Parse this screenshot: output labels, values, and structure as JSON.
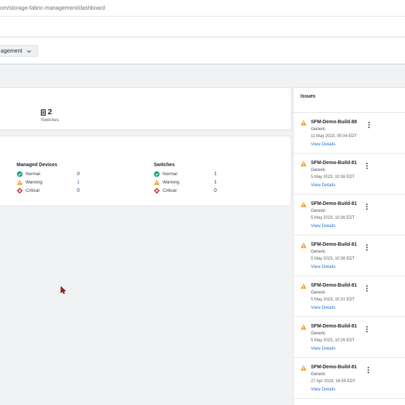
{
  "browser": {
    "url": "om/storage-fabric-management/dashboard"
  },
  "nav": {
    "dropdown_label": "agement"
  },
  "summary": {
    "switch_count": "2",
    "switch_label": "Switches"
  },
  "status": {
    "devices": {
      "title": "Managed Devices",
      "rows": [
        {
          "label": "Normal",
          "value": "0"
        },
        {
          "label": "Warning",
          "value": "1"
        },
        {
          "label": "Critical",
          "value": "0"
        }
      ]
    },
    "switches": {
      "title": "Switches",
      "rows": [
        {
          "label": "Normal",
          "value": "1"
        },
        {
          "label": "Warning",
          "value": "1"
        },
        {
          "label": "Critical",
          "value": "0"
        }
      ]
    }
  },
  "issues": {
    "title": "Issues",
    "items": [
      {
        "title": "SFM-Demo-Build-88",
        "type": "Generic",
        "time": "11 May 2023, 05:04 EDT",
        "link": "View Details"
      },
      {
        "title": "SFM-Demo-Build-81",
        "type": "Generic",
        "time": "5 May 2023, 10:36 EDT",
        "link": "View Details"
      },
      {
        "title": "SFM-Demo-Build-81",
        "type": "Generic",
        "time": "5 May 2023, 10:36 EDT",
        "link": "View Details"
      },
      {
        "title": "SFM-Demo-Build-81",
        "type": "Generic",
        "time": "5 May 2023, 10:36 EDT",
        "link": "View Details"
      },
      {
        "title": "SFM-Demo-Build-81",
        "type": "Generic",
        "time": "5 May 2023, 10:31 EDT",
        "link": "View Details"
      },
      {
        "title": "SFM-Demo-Build-81",
        "type": "Generic",
        "time": "5 May 2023, 10:26 EDT",
        "link": "View Details"
      },
      {
        "title": "SFM-Demo-Build-81",
        "type": "Generic",
        "time": "27 Apr 2023, 16:59 EDT",
        "link": "View Details"
      }
    ]
  },
  "colors": {
    "normal": "#1a9c7e",
    "warning": "#f0a32d",
    "critical": "#c8322c",
    "link": "#1f6fd1"
  }
}
